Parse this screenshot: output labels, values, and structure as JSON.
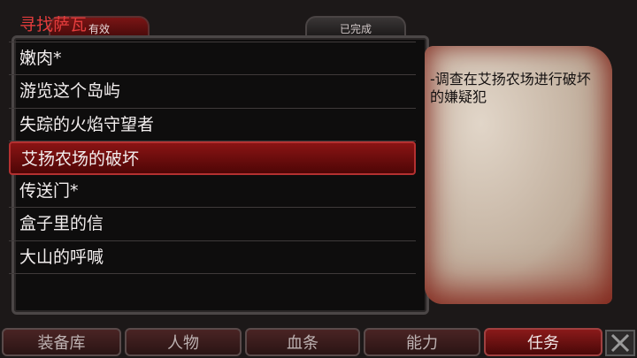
{
  "tabs": {
    "active": "有效",
    "completed": "已完成"
  },
  "quests": [
    {
      "label": "寻找萨瓦",
      "state": "highlight"
    },
    {
      "label": "嫩肉*",
      "state": "normal"
    },
    {
      "label": "游览这个岛屿",
      "state": "normal"
    },
    {
      "label": "失踪的火焰守望者",
      "state": "normal"
    },
    {
      "label": "艾扬农场的破坏",
      "state": "selected"
    },
    {
      "label": "传送门*",
      "state": "normal"
    },
    {
      "label": "盒子里的信",
      "state": "normal"
    },
    {
      "label": "大山的呼喊",
      "state": "normal"
    }
  ],
  "details": {
    "text": "-调查在艾扬农场进行破坏的嫌疑犯"
  },
  "nav": {
    "inventory": "装备库",
    "character": "人物",
    "health": "血条",
    "abilities": "能力",
    "quests": "任务"
  },
  "colors": {
    "highlight": "#e23c3c",
    "selected_bg": "#8a1414",
    "parchment": "#e6d8c6"
  }
}
